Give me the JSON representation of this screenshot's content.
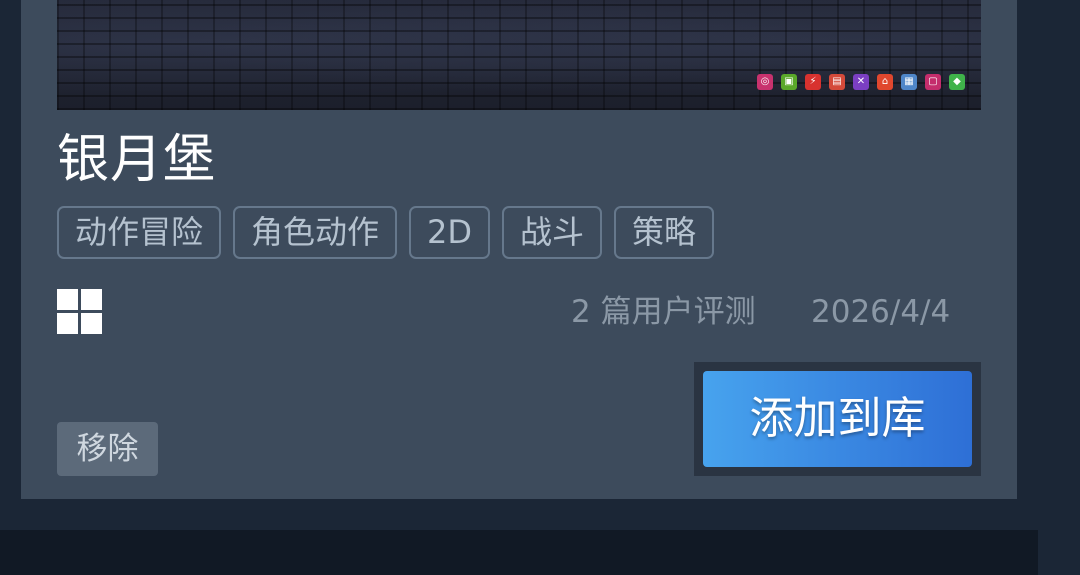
{
  "game": {
    "title": "银月堡",
    "tags": [
      "动作冒险",
      "角色动作",
      "2D",
      "战斗",
      "策略"
    ],
    "platform_icon": "windows-icon",
    "reviews": "2 篇用户评测",
    "date": "2026/4/4"
  },
  "banner": {
    "icons": [
      {
        "name": "circle-icon",
        "glyph": "◎",
        "color": "#c8326e"
      },
      {
        "name": "monitor-icon",
        "glyph": "▣",
        "color": "#5aa82a"
      },
      {
        "name": "lightning-icon",
        "glyph": "⚡",
        "color": "#d8322f"
      },
      {
        "name": "screen-icon",
        "glyph": "▤",
        "color": "#d44a3a"
      },
      {
        "name": "cross-icon",
        "glyph": "✕",
        "color": "#7b3fc2"
      },
      {
        "name": "home-icon",
        "glyph": "⌂",
        "color": "#e0472e"
      },
      {
        "name": "grid-icon",
        "glyph": "▦",
        "color": "#4f86c9"
      },
      {
        "name": "box-icon",
        "glyph": "▢",
        "color": "#c42d6c"
      },
      {
        "name": "gem-icon",
        "glyph": "◆",
        "color": "#3fb34a"
      }
    ]
  },
  "actions": {
    "add_label": "添加到库",
    "remove_label": "移除"
  },
  "colors": {
    "accent_start": "#47a3ee",
    "accent_end": "#2e6fd6",
    "card_bg": "#3d4b5c"
  }
}
